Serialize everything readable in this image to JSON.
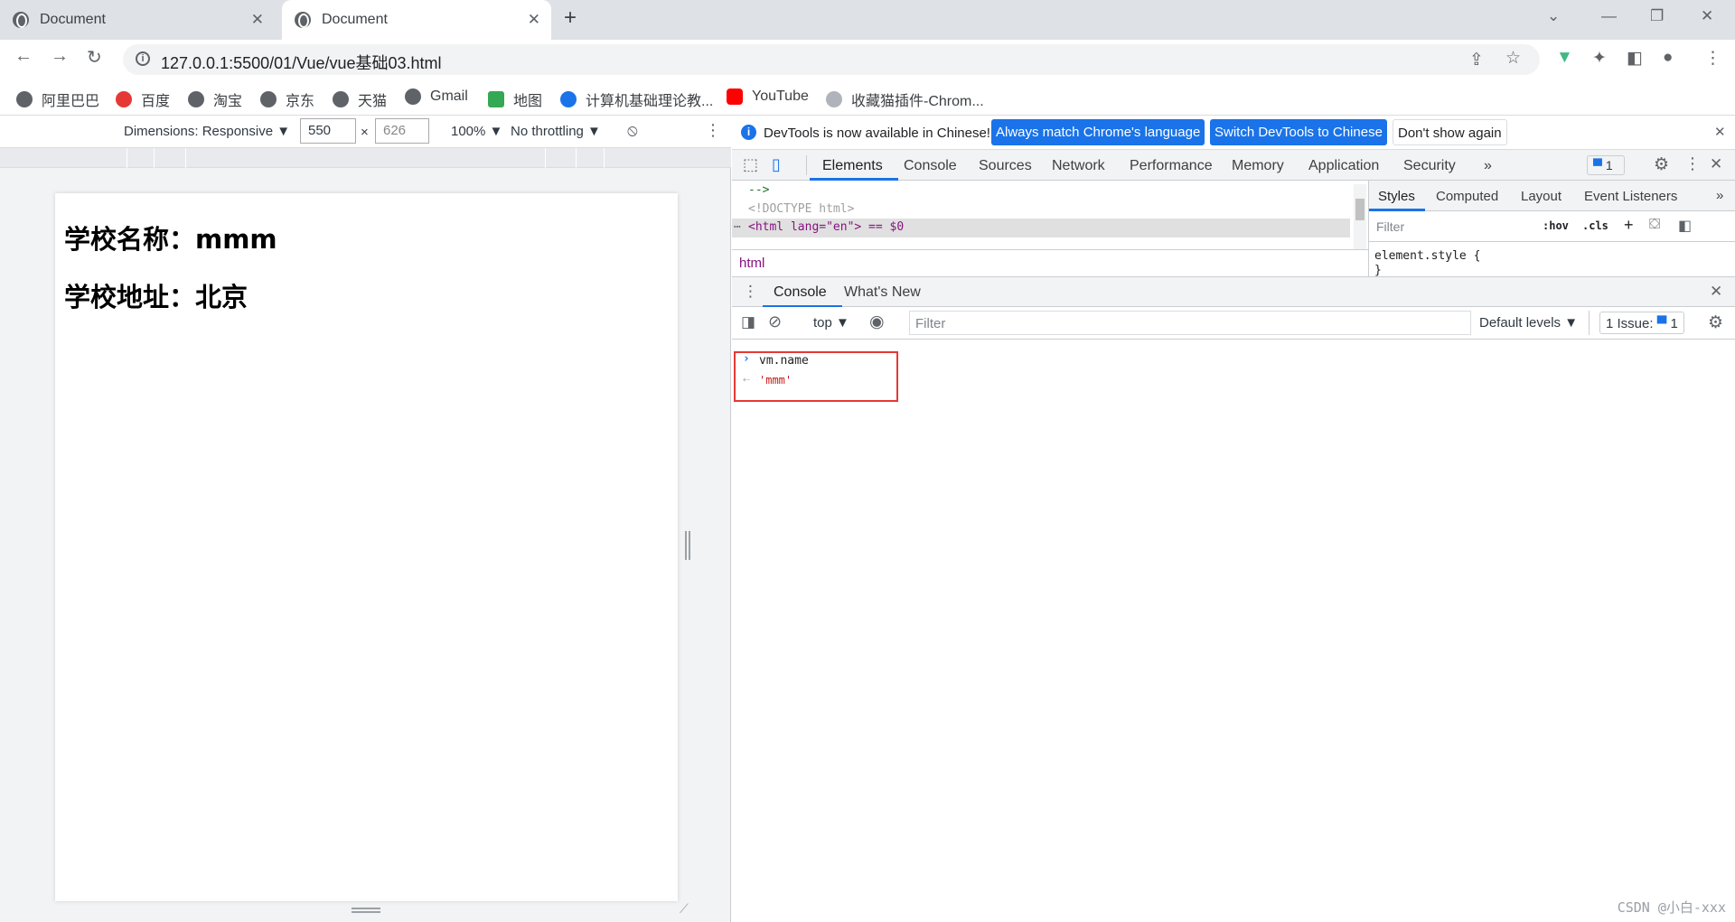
{
  "browser": {
    "tabs": [
      {
        "title": "Document"
      },
      {
        "title": "Document"
      }
    ],
    "url": "127.0.0.1:5500/01/Vue/vue基础03.html",
    "bookmarks": [
      "阿里巴巴",
      "百度",
      "淘宝",
      "京东",
      "天猫",
      "Gmail",
      "地图",
      "计算机基础理论教...",
      "YouTube",
      "收藏猫插件-Chrom..."
    ]
  },
  "device_toolbar": {
    "dimensions": "Dimensions: Responsive ▼",
    "width": "550",
    "height": "626",
    "zoom": "100% ▼",
    "throttling": "No throttling ▼"
  },
  "page": {
    "school_name": "学校名称：mmm",
    "school_address": "学校地址：北京"
  },
  "devtools": {
    "info_text": "DevTools is now available in Chinese!",
    "btn_match": "Always match Chrome's language",
    "btn_switch": "Switch DevTools to Chinese",
    "btn_dont_show": "Don't show again",
    "tabs": [
      "Elements",
      "Console",
      "Sources",
      "Network",
      "Performance",
      "Memory",
      "Application",
      "Security"
    ],
    "issues_badge": "1",
    "elements_lines": [
      "-->",
      "<!DOCTYPE html>",
      "<html lang=\"en\"> == $0"
    ],
    "breadcrumb": "html",
    "styles_tabs": [
      "Styles",
      "Computed",
      "Layout",
      "Event Listeners"
    ],
    "styles_filter": "Filter",
    "hov": ":hov",
    "cls": ".cls",
    "element_style": "element.style {",
    "drawer_tabs": [
      "Console",
      "What's New"
    ],
    "context": "top ▼",
    "console_filter": "Filter",
    "levels": "Default levels ▼",
    "issues": "1 Issue:",
    "issues_count": "1",
    "input": "vm.name",
    "output": "'mmm'"
  },
  "watermark": "CSDN @小白-xxx"
}
